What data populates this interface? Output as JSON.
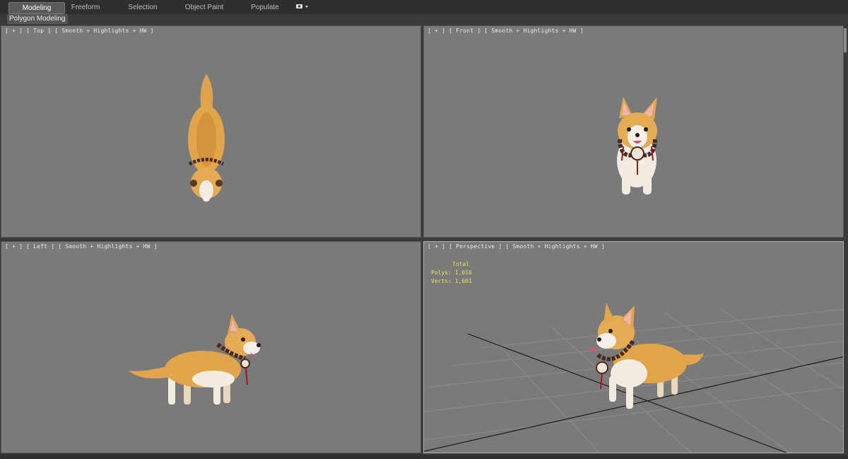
{
  "ribbon": {
    "tabs": [
      {
        "label": "Modeling",
        "active": true
      },
      {
        "label": "Freeform",
        "active": false
      },
      {
        "label": "Selection",
        "active": false
      },
      {
        "label": "Object Paint",
        "active": false
      },
      {
        "label": "Populate",
        "active": false
      }
    ],
    "extra_icon": "camera-dropdown-icon",
    "subtab": "Polygon Modeling"
  },
  "viewports": {
    "top": {
      "label": "[ + ] [ Top ] [ Smooth + Highlights + HW ]"
    },
    "front": {
      "label": "[ + ] [ Front ] [ Smooth + Highlights + HW ]"
    },
    "left": {
      "label": "[ + ] [ Left ] [ Smooth + Highlights + HW ]"
    },
    "perspective": {
      "label": "[ + ] [ Perspective ] [ Smooth + Highlights + HW ]",
      "stats": {
        "header": "Total",
        "polys_label": "Polys:",
        "polys": "1,016",
        "verts_label": "Verts:",
        "verts": "1,601"
      }
    }
  },
  "colors": {
    "viewport_bg": "#7a7a7a",
    "stats_text": "#e8e25a",
    "dog_fur": "#e3a54a",
    "dog_white": "#f2ece2"
  }
}
